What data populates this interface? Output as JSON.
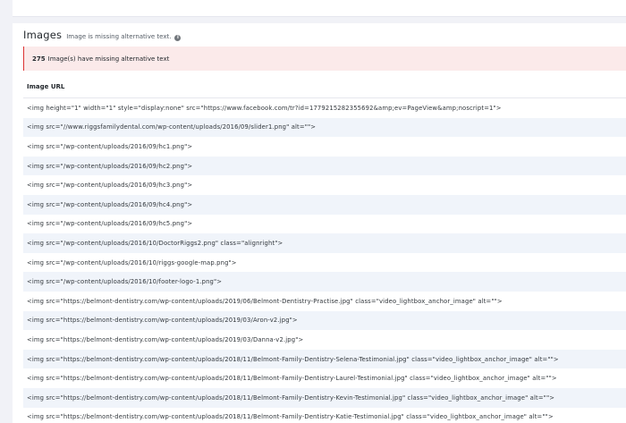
{
  "section": {
    "title": "Images",
    "subtitle": "Image is missing alternative text.",
    "info_icon": "info-icon"
  },
  "alert": {
    "count": "275",
    "text": "Image(s) have missing alternative text"
  },
  "table": {
    "column_header": "Image URL",
    "rows": [
      "<img height=\"1\" width=\"1\" style=\"display:none\" src=\"https://www.facebook.com/tr?id=1779215282355692&amp;ev=PageView&amp;noscript=1\">",
      "<img src=\"//www.riggsfamilydental.com/wp-content/uploads/2016/09/slider1.png\" alt=\"\">",
      "<img src=\"/wp-content/uploads/2016/09/hc1.png\">",
      "<img src=\"/wp-content/uploads/2016/09/hc2.png\">",
      "<img src=\"/wp-content/uploads/2016/09/hc3.png\">",
      "<img src=\"/wp-content/uploads/2016/09/hc4.png\">",
      "<img src=\"/wp-content/uploads/2016/09/hc5.png\">",
      "<img src=\"/wp-content/uploads/2016/10/DoctorRiggs2.png\" class=\"alignright\">",
      "<img src=\"/wp-content/uploads/2016/10/riggs-google-map.png\">",
      "<img src=\"/wp-content/uploads/2016/10/footer-logo-1.png\">",
      "<img src=\"https://belmont-dentistry.com/wp-content/uploads/2019/06/Belmont-Dentistry-Practise.jpg\" class=\"video_lightbox_anchor_image\" alt=\"\">",
      "<img src=\"https://belmont-dentistry.com/wp-content/uploads/2019/03/Aron-v2.jpg\">",
      "<img src=\"https://belmont-dentistry.com/wp-content/uploads/2019/03/Danna-v2.jpg\">",
      "<img src=\"https://belmont-dentistry.com/wp-content/uploads/2018/11/Belmont-Family-Dentistry-Selena-Testimonial.jpg\" class=\"video_lightbox_anchor_image\" alt=\"\">",
      "<img src=\"https://belmont-dentistry.com/wp-content/uploads/2018/11/Belmont-Family-Dentistry-Laurel-Testimonial.jpg\" class=\"video_lightbox_anchor_image\" alt=\"\">",
      "<img src=\"https://belmont-dentistry.com/wp-content/uploads/2018/11/Belmont-Family-Dentistry-Kevin-Testimonial.jpg\" class=\"video_lightbox_anchor_image\" alt=\"\">",
      "<img src=\"https://belmont-dentistry.com/wp-content/uploads/2018/11/Belmont-Family-Dentistry-Katie-Testimonial.jpg\" class=\"video_lightbox_anchor_image\" alt=\"\">"
    ]
  },
  "colors": {
    "alert_background": "#fbeaea",
    "alert_border": "#dc3232",
    "row_alt": "#f0f4fa"
  }
}
